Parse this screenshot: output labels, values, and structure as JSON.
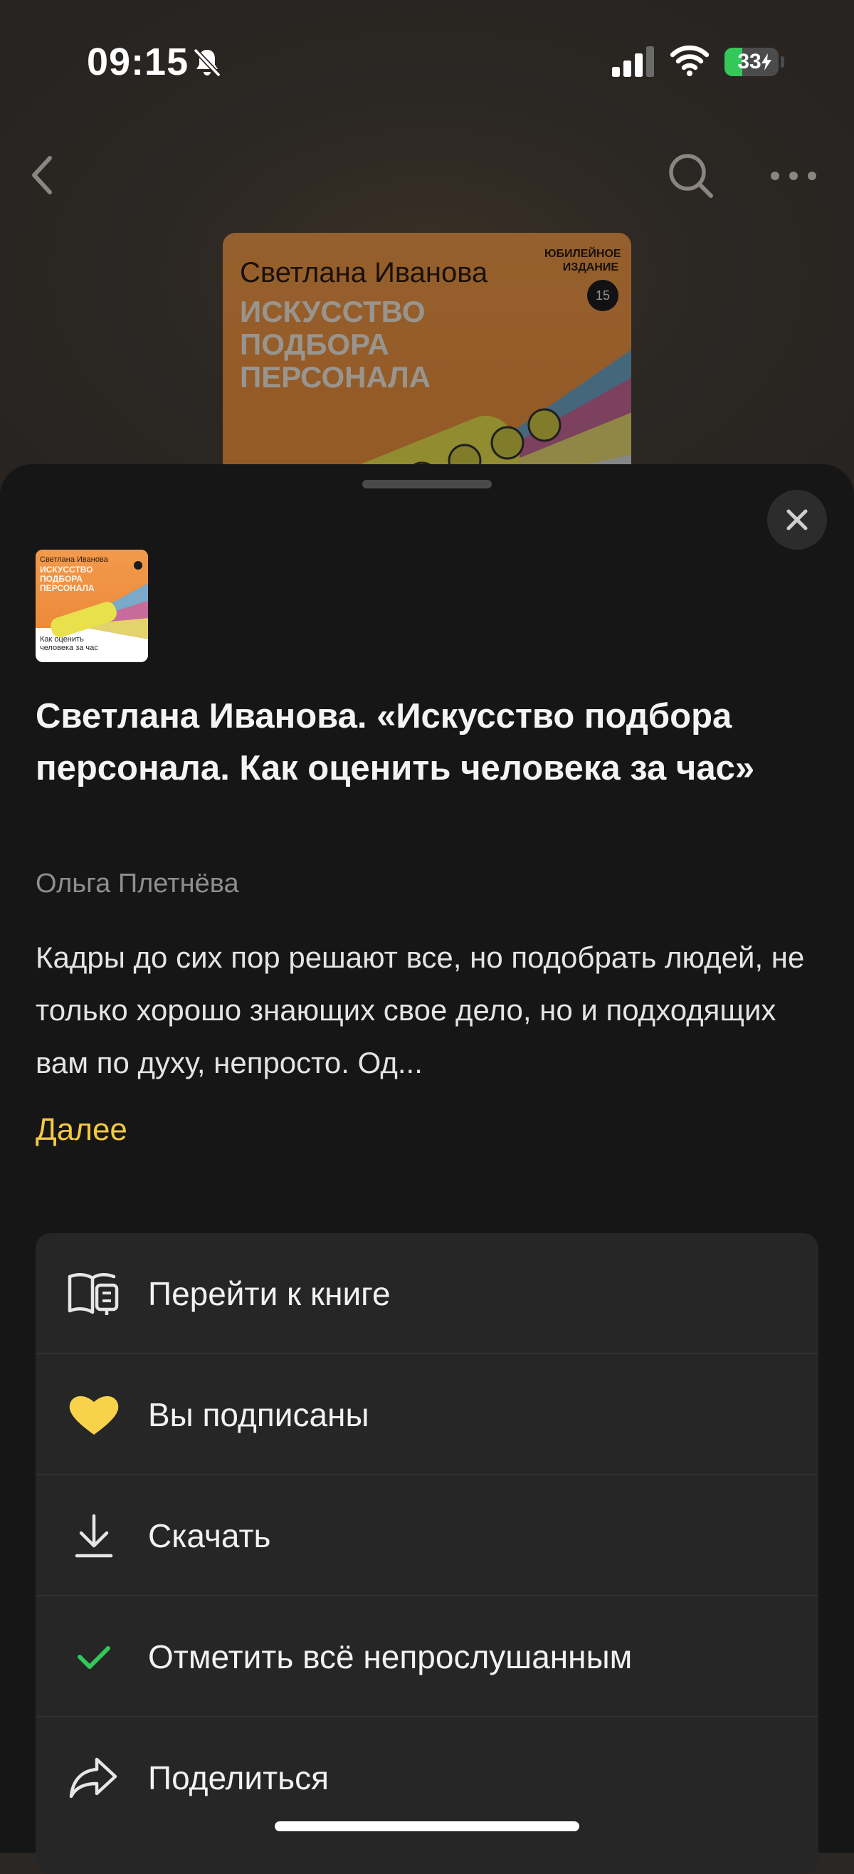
{
  "status_bar": {
    "time": "09:15",
    "battery_level": "33",
    "battery_fill_percent": 33,
    "icons": [
      "bell-slash-icon",
      "signal-icon",
      "wifi-icon",
      "battery-icon",
      "charging-bolt-icon"
    ]
  },
  "nav": {
    "icons": [
      "chevron-left-icon",
      "search-icon",
      "more-icon"
    ]
  },
  "cover": {
    "author": "Светлана Иванова",
    "title": "ИСКУССТВО ПОДБОРА ПЕРСОНАЛА",
    "badge": "ЮБИЛЕЙНОЕ ИЗДАНИЕ",
    "badge_number": "15",
    "subtitle": "Как оценить человека за час"
  },
  "episode": {
    "title": "Светлана Иванова. «Искусство подбора персонала. Как оценить человека за час»",
    "author": "Ольга Плетнёва",
    "description": "Кадры до сих пор решают все, но подобрать людей, не только хорошо знающих свое дело, но и подходящих вам по духу, непросто. Од...",
    "more_label": "Далее"
  },
  "menu": {
    "items": [
      {
        "label": "Перейти к книге",
        "icon": "book-icon"
      },
      {
        "label": "Вы подписаны",
        "icon": "heart-icon"
      },
      {
        "label": "Скачать",
        "icon": "download-icon"
      },
      {
        "label": "Отметить всё непрослушанным",
        "icon": "checkmark-icon"
      },
      {
        "label": "Поделиться",
        "icon": "share-icon"
      }
    ]
  },
  "colors": {
    "accent_yellow": "#f5c842",
    "heart": "#f7d24a",
    "check_green": "#34c759",
    "sheet_bg": "#161616",
    "menu_bg": "#262626"
  }
}
